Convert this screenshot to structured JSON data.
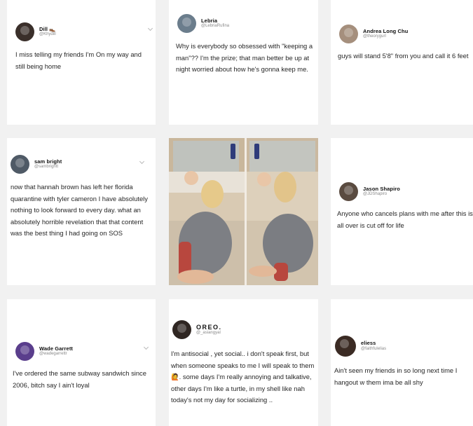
{
  "tweets": [
    {
      "name": "Dill 👞",
      "handle": "@Khydill",
      "text": "I miss telling my friends I'm On my way and still being home",
      "avatar_color": "#3a2f2a"
    },
    {
      "name": "Lebria",
      "handle": "@LebriaRufina",
      "text": "Why is everybody so obsessed with \"keeping a man\"?? I'm the prize; that man better be up at night worried about how he's gonna keep me.",
      "avatar_color": "#6b7d8c"
    },
    {
      "name": "Andrea Long Chu",
      "handle": "@theorygurl",
      "text": "guys will stand 5'8\" from you and call it 6 feet",
      "avatar_color": "#a58f7d"
    },
    {
      "name": "sam bright",
      "handle": "@sambrightt",
      "text": "now that hannah brown has left her florida quarantine with tyler cameron I have absolutely nothing to look forward to every day. what an absolutely horrible revelation that that content was the best thing I had going on SOS",
      "avatar_color": "#4f5a66"
    },
    {
      "name": "Jason Shapiro",
      "handle": "@JDShapiro",
      "text": "Anyone who cancels plans with me after this is all over is cut off for life",
      "avatar_color": "#5a4b40"
    },
    {
      "name": "Wade Garrett",
      "handle": "@wadegarrettr",
      "text": "I've ordered the same subway sandwich since 2006, bitch say I ain't loyal",
      "avatar_color": "#5a3e8c"
    },
    {
      "name": "OREO.",
      "handle": "@_asiangyal",
      "text": "I'm antisocial , yet social.. i don't speak first, but when someone speaks to me I will speak to them 🙋. some days I'm really annoying and talkative, other days I'm like a turtle, in my shell like nah today's not my day for socializing ..",
      "avatar_color": "#2f2622"
    },
    {
      "name": "eliess",
      "handle": "@faithfulelias",
      "text": "Ain't seen my friends in so long next time I hangout w them ima be all shy",
      "avatar_color": "#3b2b24"
    }
  ]
}
